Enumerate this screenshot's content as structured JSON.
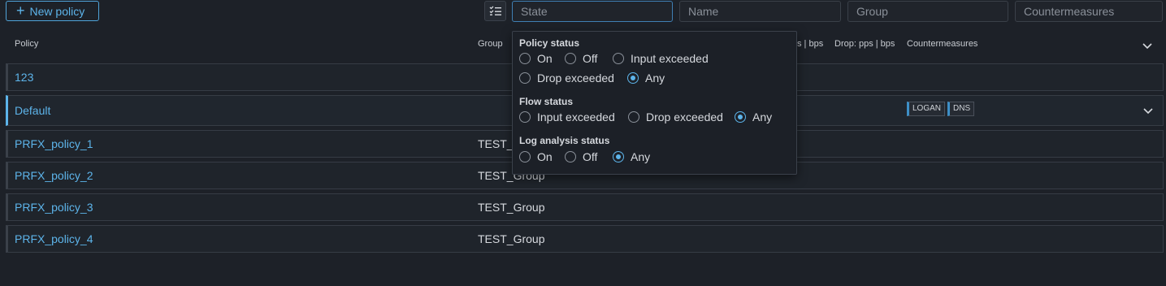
{
  "toolbar": {
    "new_policy_label": "New policy",
    "filters": {
      "state_placeholder": "State",
      "name_placeholder": "Name",
      "group_placeholder": "Group",
      "countermeasures_placeholder": "Countermeasures"
    }
  },
  "columns": {
    "policy": "Policy",
    "group": "Group",
    "input_partial": "s | bps",
    "drop": "Drop:  pps | bps",
    "countermeasures": "Countermeasures"
  },
  "rows": [
    {
      "name": "123",
      "group": ""
    },
    {
      "name": "Default",
      "group": "",
      "badges": [
        "LOGAN",
        "DNS"
      ]
    },
    {
      "name": "PRFX_policy_1",
      "group": "TEST_Group"
    },
    {
      "name": "PRFX_policy_2",
      "group": "TEST_Group"
    },
    {
      "name": "PRFX_policy_3",
      "group": "TEST_Group"
    },
    {
      "name": "PRFX_policy_4",
      "group": "TEST_Group"
    }
  ],
  "state_popover": {
    "policy_status": {
      "title": "Policy status",
      "options": [
        "On",
        "Off",
        "Input exceeded",
        "Drop exceeded",
        "Any"
      ],
      "selected": "Any"
    },
    "flow_status": {
      "title": "Flow status",
      "options": [
        "Input exceeded",
        "Drop exceeded",
        "Any"
      ],
      "selected": "Any"
    },
    "log_analysis_status": {
      "title": "Log analysis status",
      "options": [
        "On",
        "Off",
        "Any"
      ],
      "selected": "Any"
    }
  },
  "colors": {
    "accent": "#5db4ea",
    "background": "#1d2128",
    "row_border": "#363c45"
  }
}
